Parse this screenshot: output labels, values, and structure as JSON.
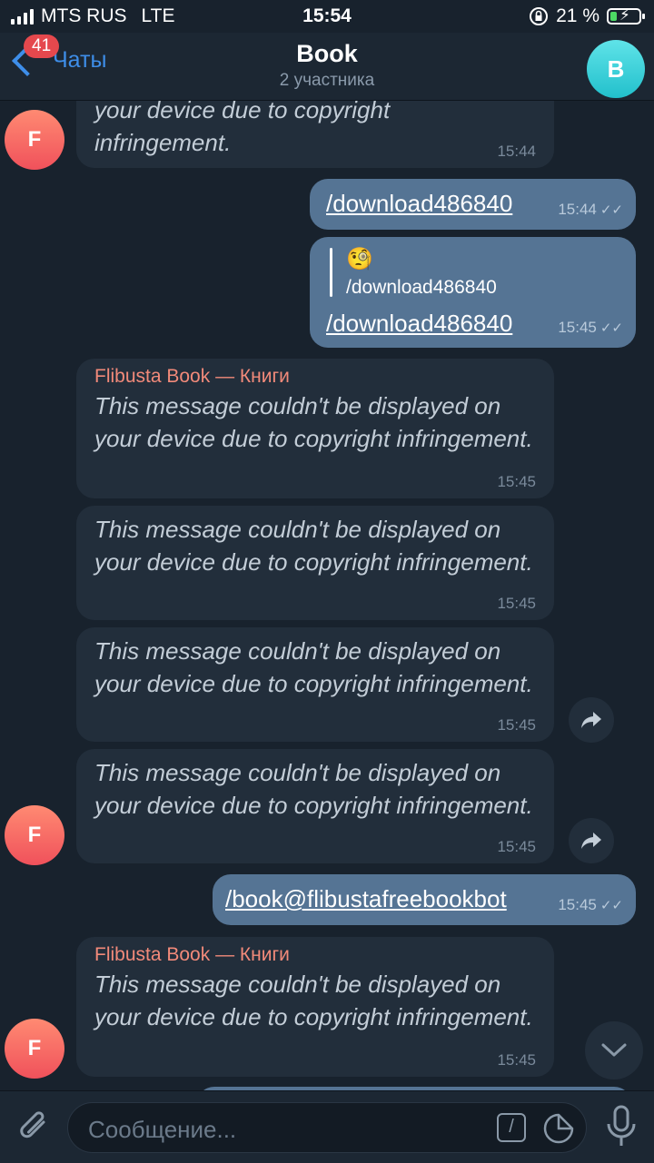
{
  "status_bar": {
    "carrier": "MTS RUS",
    "network": "LTE",
    "time": "15:54",
    "battery_percent": "21 %"
  },
  "header": {
    "back_label": "Чаты",
    "unread_badge": "41",
    "title": "Book",
    "subtitle": "2 участника",
    "avatar_letter": "B"
  },
  "messages": [
    {
      "dir": "in",
      "text_top": "your device due to copyright",
      "text_bottom": "infringement.",
      "time": "15:44"
    },
    {
      "dir": "out",
      "link": "/download486840",
      "time": "15:44"
    },
    {
      "dir": "out",
      "reply_emoji": "🧐",
      "reply_text": "/download486840",
      "link": "/download486840",
      "time": "15:45"
    },
    {
      "dir": "in",
      "sender": "Flibusta Book — Книги",
      "text": "This message couldn't be displayed on your device due to copyright infringement.",
      "time": "15:45"
    },
    {
      "dir": "in",
      "text": "This message couldn't be displayed on your device due to copyright infringement.",
      "time": "15:45"
    },
    {
      "dir": "in",
      "text": "This message couldn't be displayed on your device due to copyright infringement.",
      "time": "15:45"
    },
    {
      "dir": "in",
      "text": "This message couldn't be displayed on your device due to copyright infringement.",
      "time": "15:45"
    },
    {
      "dir": "out",
      "link": "/book@flibustafreebookbot",
      "time": "15:45"
    },
    {
      "dir": "in",
      "sender": "Flibusta Book — Книги",
      "text": "This message couldn't be displayed on your device due to copyright infringement.",
      "time": "15:45"
    }
  ],
  "sender_avatar_letter": "F",
  "input": {
    "placeholder": "Сообщение..."
  },
  "colors": {
    "background": "#18222d",
    "incoming_bubble": "#222e3b",
    "outgoing_bubble": "#557494",
    "accent": "#3e8ee9",
    "sender_name": "#f28a7a"
  }
}
